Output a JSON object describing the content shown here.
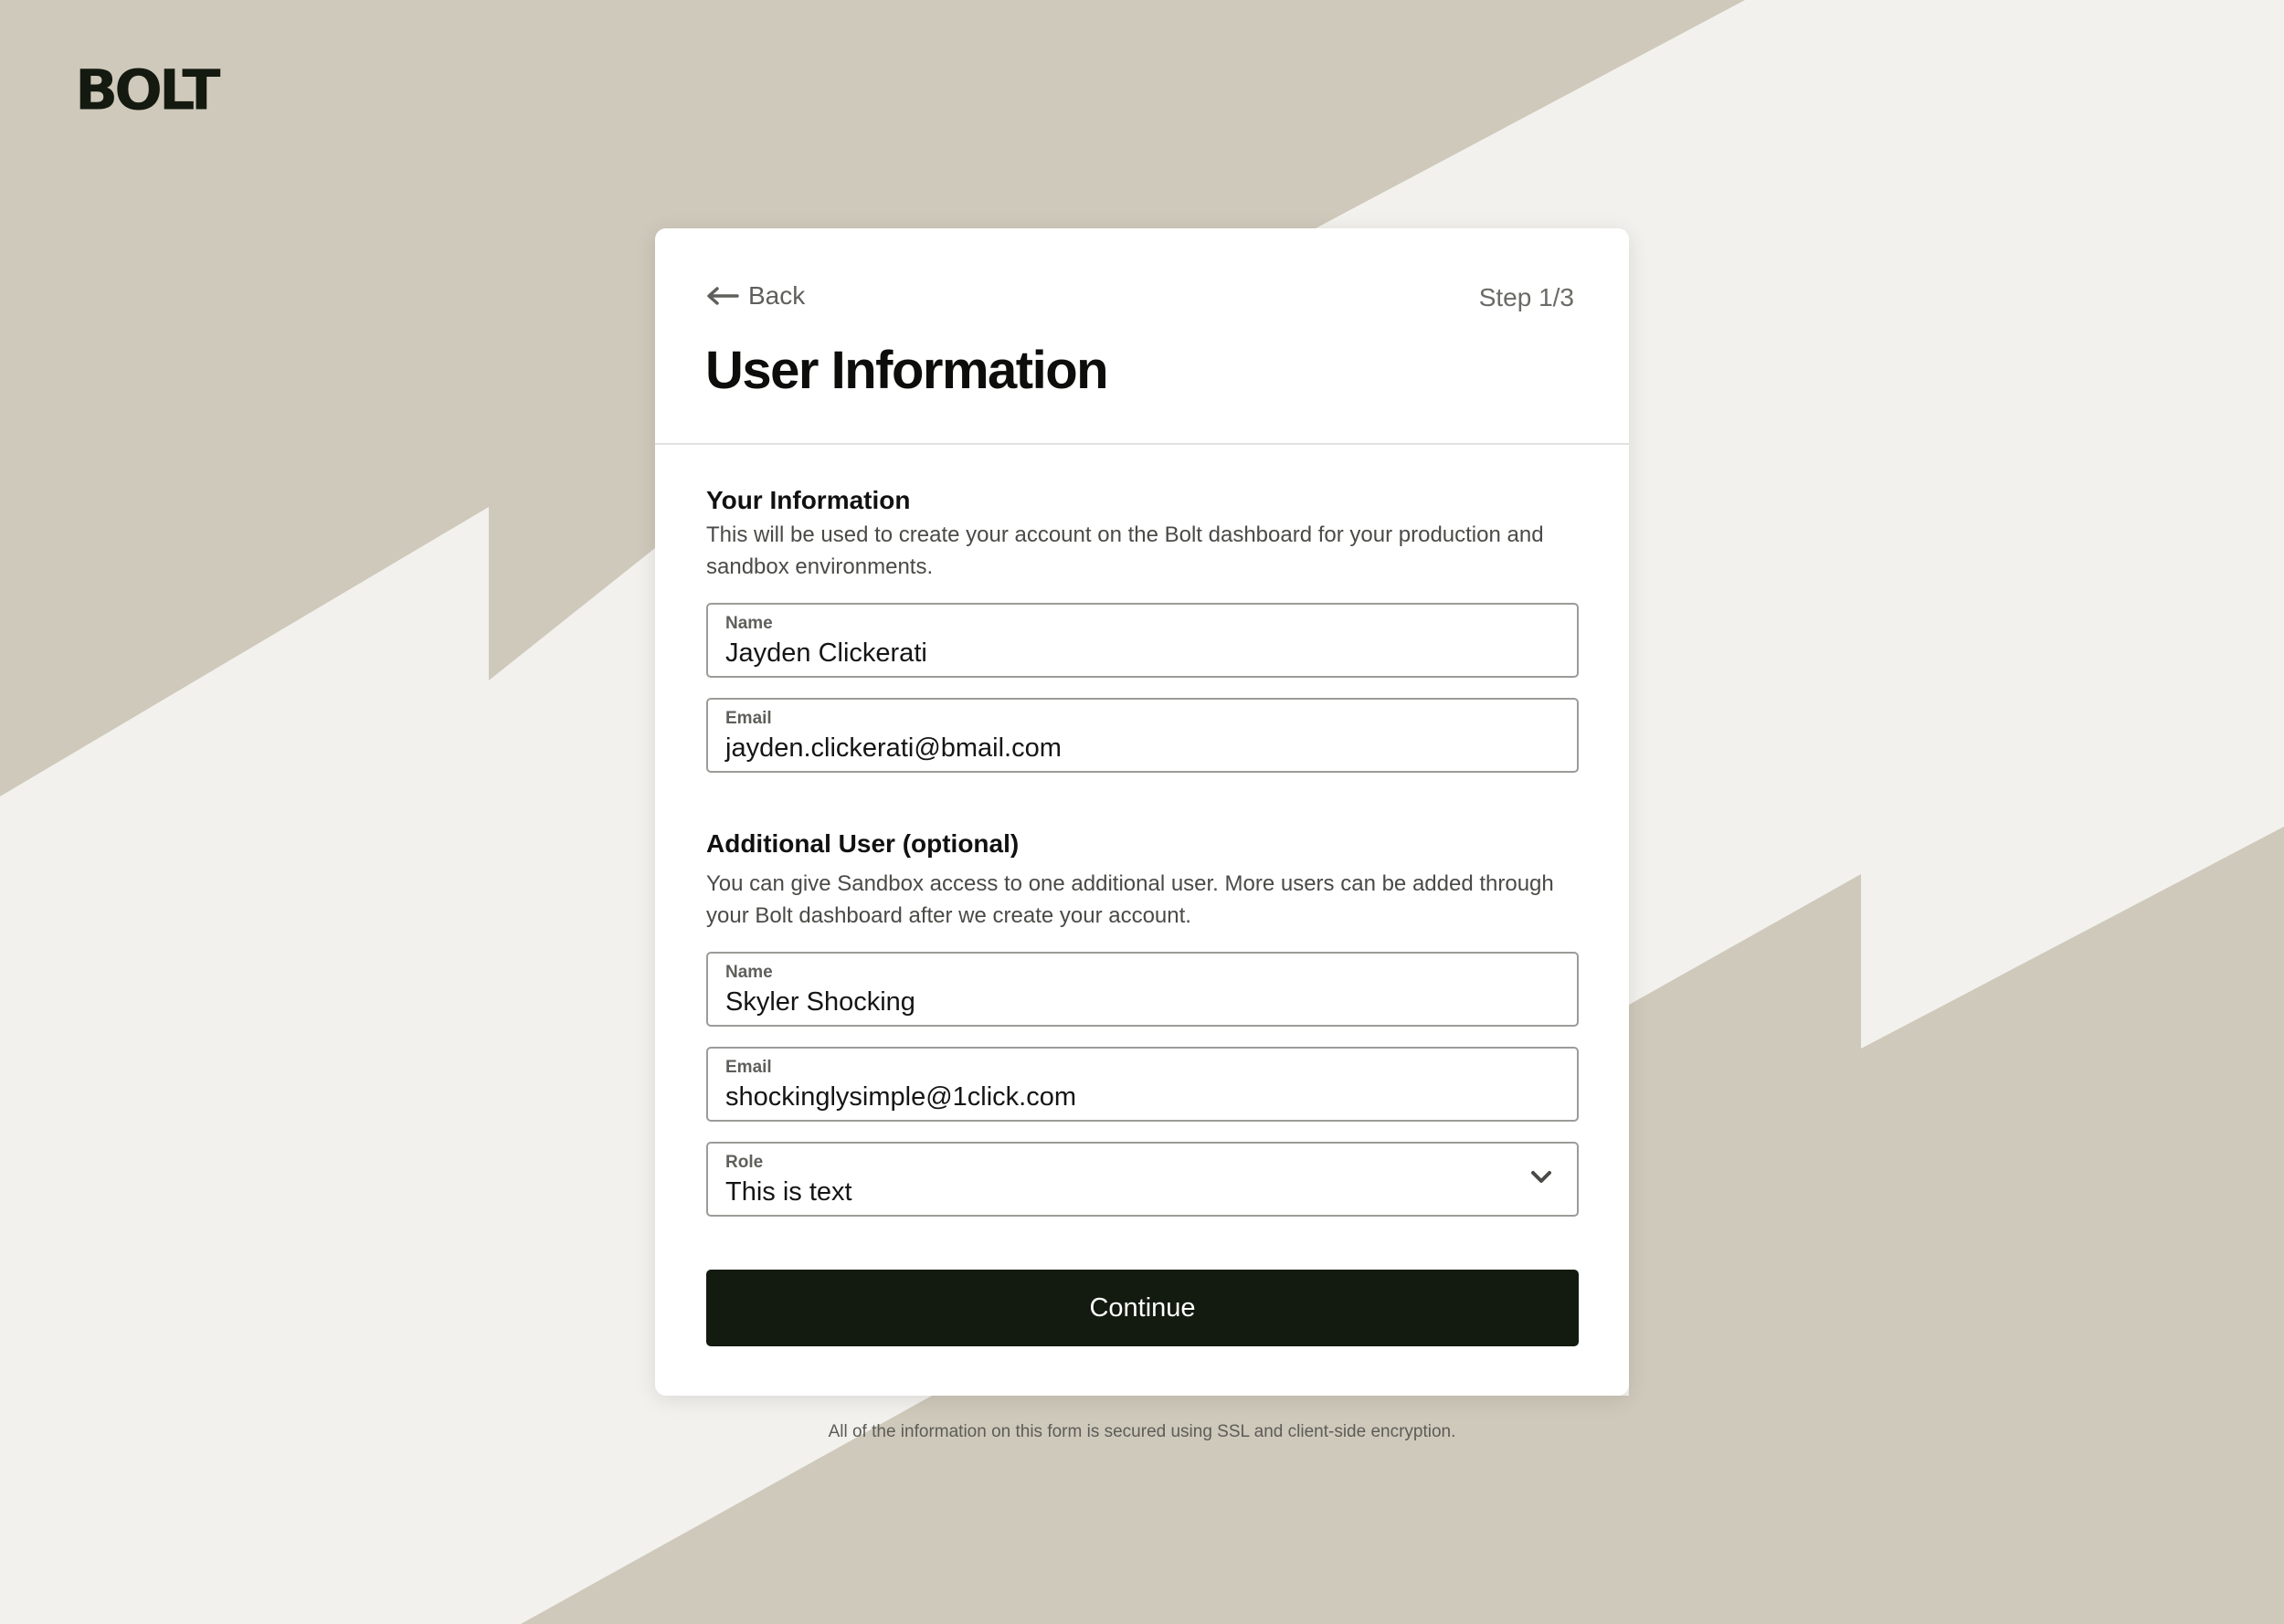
{
  "brand": {
    "logo_text": "BOLT"
  },
  "colors": {
    "background_light": "#f2f1ed",
    "background_tan": "#cfc9bb",
    "button_dark": "#131a0f",
    "card": "#ffffff"
  },
  "header": {
    "back_label": "Back",
    "step_label": "Step 1/3",
    "title": "User Information"
  },
  "your_info": {
    "title": "Your Information",
    "description": "This will be used to create your account on the Bolt dashboard for your production and sandbox environments.",
    "name_label": "Name",
    "name_value": "Jayden Clickerati",
    "email_label": "Email",
    "email_value": "jayden.clickerati@bmail.com"
  },
  "additional_user": {
    "title": "Additional User (optional)",
    "description": "You can give Sandbox access to one additional user. More users can be added through your Bolt dashboard after we create your account.",
    "name_label": "Name",
    "name_value": "Skyler Shocking",
    "email_label": "Email",
    "email_value": "shockinglysimple@1click.com",
    "role_label": "Role",
    "role_value": "This is text",
    "role_icon": "chevron-down-icon"
  },
  "actions": {
    "continue_label": "Continue"
  },
  "footer": {
    "note": "All of the information on this form is secured using SSL and client-side encryption."
  }
}
